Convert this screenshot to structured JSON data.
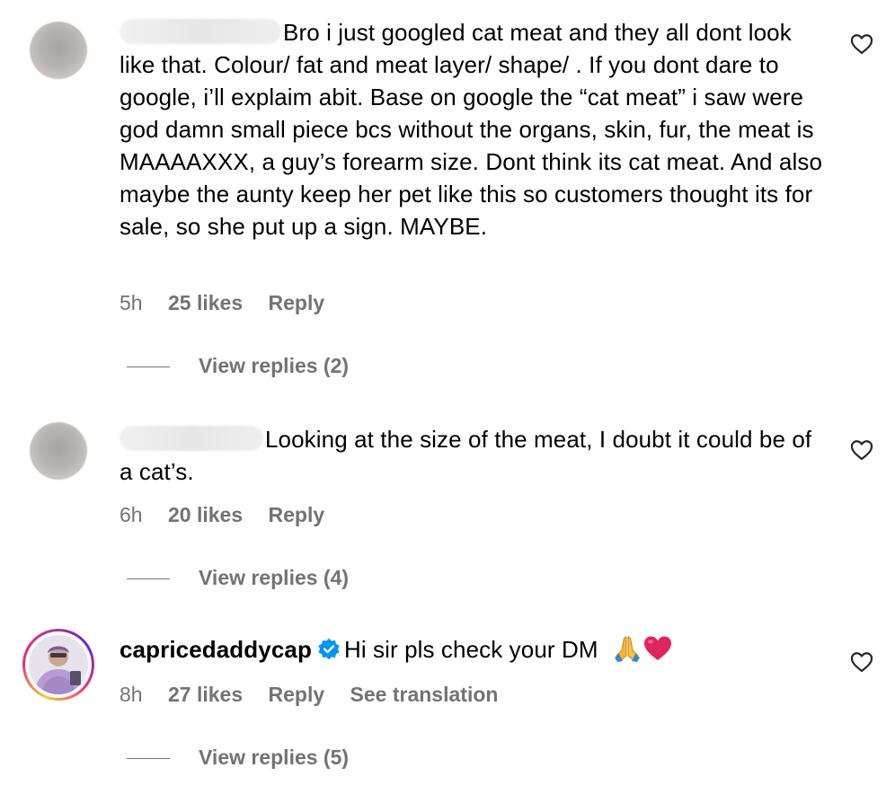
{
  "comments": [
    {
      "text": "Bro i just googled cat meat and they all dont look like that. Colour/ fat and meat layer/ shape/ . If you dont dare to google, i’ll explaim abit. Base on google the “cat meat” i saw were god damn small piece bcs without the organs, skin, fur, the meat is MAAAAXXX, a guy’s forearm size. Dont think its cat meat. And also maybe the aunty keep her pet like this so customers thought its for sale, so she put up a sign. MAYBE.",
      "time": "5h",
      "likes": "25 likes",
      "reply_label": "Reply",
      "view_replies": "View replies (2)"
    },
    {
      "text": "Looking at the size of the meat, I doubt it could be of a cat’s.",
      "time": "6h",
      "likes": "20 likes",
      "reply_label": "Reply",
      "view_replies": "View replies (4)"
    },
    {
      "username": "capricedaddycap",
      "text": "Hi sir pls check your DM",
      "time": "8h",
      "likes": "27 likes",
      "reply_label": "Reply",
      "translation_label": "See translation",
      "view_replies": "View replies (5)"
    }
  ],
  "icons": {
    "like": "heart-outline-icon",
    "verified": "verified-badge-icon",
    "emoji_1": "folded-hands-emoji",
    "emoji_2": "red-heart-emoji"
  },
  "colors": {
    "text": "#000000",
    "meta": "#737373",
    "verified": "#0095f6",
    "heart_emoji": "#e0245e"
  }
}
